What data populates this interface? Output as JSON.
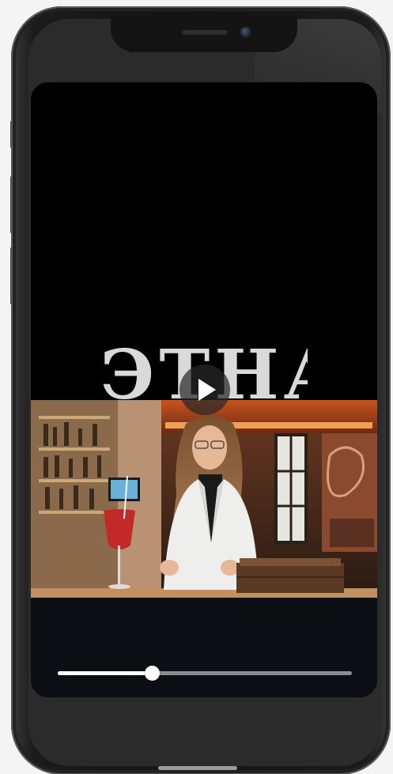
{
  "video": {
    "title_text": "ЭТНА",
    "playback_progress": 0.32,
    "state": "paused"
  },
  "icons": {
    "play": "play-icon",
    "camera": "front-camera-icon",
    "speaker": "earpiece-speaker-icon"
  },
  "colors": {
    "screen_background": "#000000",
    "player_bar": "#0b0f14",
    "progress_played": "#ffffff",
    "progress_remaining": "#8a8d91",
    "page_background": "#f3f4f3"
  }
}
